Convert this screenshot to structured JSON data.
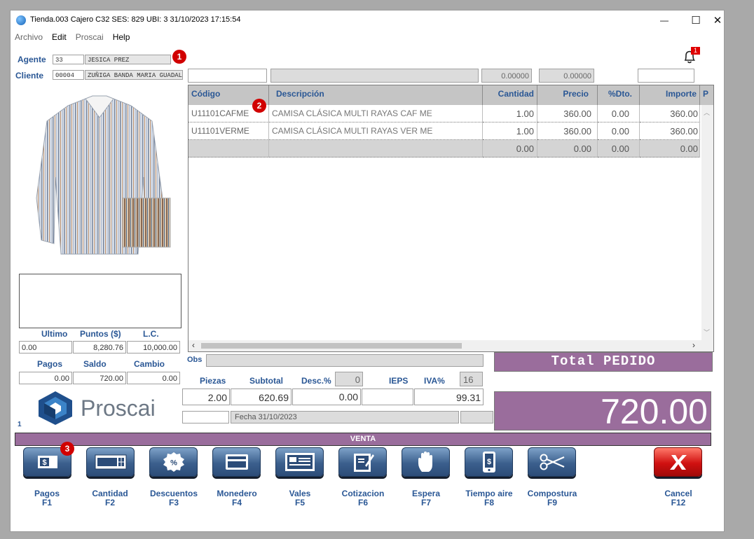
{
  "window": {
    "title": "Tienda.003  Cajero C32     SES: 829   UBI: 3   31/10/2023 17:15:54",
    "minimize_glyph": "—",
    "maximize_glyph": "☐",
    "close_glyph": "✕"
  },
  "menu": [
    "Archivo",
    "Edit",
    "Proscai",
    "Help"
  ],
  "header": {
    "agente_label": "Agente",
    "agente_code": "33",
    "agente_name": "JESICA PREZ",
    "cliente_label": "Cliente",
    "cliente_code": "00004",
    "cliente_name": "ZUÑIGA BANDA MARIA GUADALUPE",
    "num_a": "0.00000",
    "num_b": "0.00000",
    "notification_count": "1"
  },
  "badges": [
    "1",
    "2",
    "3"
  ],
  "grid": {
    "columns": [
      "Código",
      "Descripción",
      "Cantidad",
      "Precio",
      "%Dto.",
      "Importe",
      "P"
    ],
    "rows": [
      {
        "codigo": "U11101CAFME",
        "descripcion": "CAMISA CLÁSICA MULTI RAYAS CAF ME",
        "cantidad": "1.00",
        "precio": "360.00",
        "dto": "0.00",
        "importe": "360.00"
      },
      {
        "codigo": "U11101VERME",
        "descripcion": "CAMISA CLÁSICA MULTI RAYAS VER ME",
        "cantidad": "1.00",
        "precio": "360.00",
        "dto": "0.00",
        "importe": "360.00"
      },
      {
        "codigo": "",
        "descripcion": "",
        "cantidad": "0.00",
        "precio": "0.00",
        "dto": "0.00",
        "importe": "0.00"
      }
    ]
  },
  "left_panel": {
    "ultimo_label": "Ultimo",
    "puntos_label": "Puntos ($)",
    "lc_label": "L.C.",
    "ultimo": "0.00",
    "puntos": "8,280.76",
    "lc": "10,000.00",
    "pagos_label": "Pagos",
    "saldo_label": "Saldo",
    "cambio_label": "Cambio",
    "pagos": "0.00",
    "saldo": "720.00",
    "cambio": "0.00",
    "logo_text": "Proscai",
    "page_num": "1"
  },
  "summary": {
    "obs_label": "Obs",
    "piezas_label": "Piezas",
    "subtotal_label": "Subtotal",
    "desc_label": "Desc.%",
    "desc_pct": "0",
    "ieps_label": "IEPS",
    "iva_label": "IVA%",
    "iva_pct": "16",
    "piezas": "2.00",
    "subtotal": "620.69",
    "descuento": "0.00",
    "ieps": "",
    "iva": "99.31",
    "fecha": "Fecha 31/10/2023",
    "total_title": "Total PEDIDO",
    "total": "720.00"
  },
  "venta_label": "VENTA",
  "toolbar": [
    {
      "label": "Pagos",
      "key": "F1",
      "icon": "cash-icon"
    },
    {
      "label": "Cantidad",
      "key": "F2",
      "icon": "calculator-icon"
    },
    {
      "label": "Descuentos",
      "key": "F3",
      "icon": "percent-icon"
    },
    {
      "label": "Monedero",
      "key": "F4",
      "icon": "wallet-card-icon"
    },
    {
      "label": "Vales",
      "key": "F5",
      "icon": "voucher-icon"
    },
    {
      "label": "Cotizacion",
      "key": "F6",
      "icon": "quote-icon"
    },
    {
      "label": "Espera",
      "key": "F7",
      "icon": "hand-icon"
    },
    {
      "label": "Tiempo aire",
      "key": "F8",
      "icon": "phone-icon"
    },
    {
      "label": "Compostura",
      "key": "F9",
      "icon": "scissors-icon"
    },
    {
      "label": "Cancel",
      "key": "F12",
      "icon": "cancel-icon"
    }
  ],
  "colors": {
    "accent_purple": "#9a6d9c",
    "label_blue": "#2a5795",
    "button_blue": "#3b5f8d",
    "cancel_red": "#d01010"
  }
}
